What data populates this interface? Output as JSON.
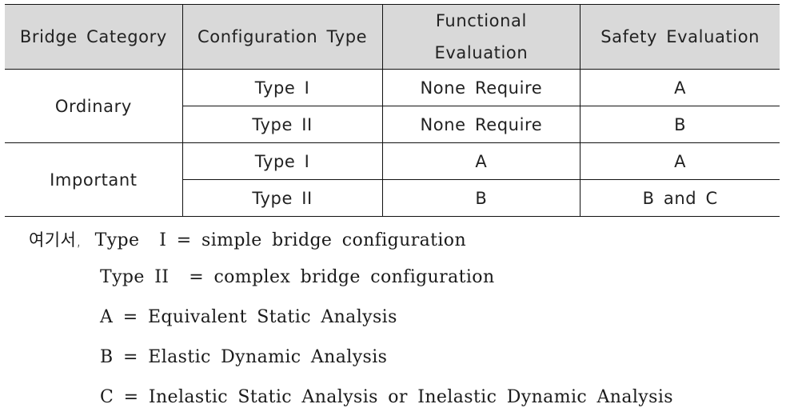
{
  "table": {
    "headers": [
      "Bridge Category",
      "Configuration Type",
      "Functional Evaluation",
      "Safety Evaluation"
    ],
    "header_fill_color": "#d9d9d9",
    "groups": [
      {
        "category": "Ordinary",
        "rows": [
          {
            "configuration": "Type I",
            "functional": "None Require",
            "safety": "A"
          },
          {
            "configuration": "Type II",
            "functional": "None Require",
            "safety": "B"
          }
        ]
      },
      {
        "category": "Important",
        "rows": [
          {
            "configuration": "Type I",
            "functional": "A",
            "safety": "A"
          },
          {
            "configuration": "Type II",
            "functional": "B",
            "safety": "B and C"
          }
        ]
      }
    ]
  },
  "legend": {
    "prefix": "여기서,",
    "definitions": [
      {
        "term": "Type  I",
        "sep": "=",
        "meaning": "simple bridge configuration"
      },
      {
        "term": "Type II ",
        "sep": "=",
        "meaning": "complex bridge configuration"
      },
      {
        "term": "A",
        "sep": "=",
        "meaning": "Equivalent Static Analysis"
      },
      {
        "term": "B",
        "sep": "=",
        "meaning": "Elastic Dynamic Analysis"
      },
      {
        "term": "C",
        "sep": "=",
        "meaning": "Inelastic Static Analysis or Inelastic Dynamic Analysis"
      }
    ]
  }
}
